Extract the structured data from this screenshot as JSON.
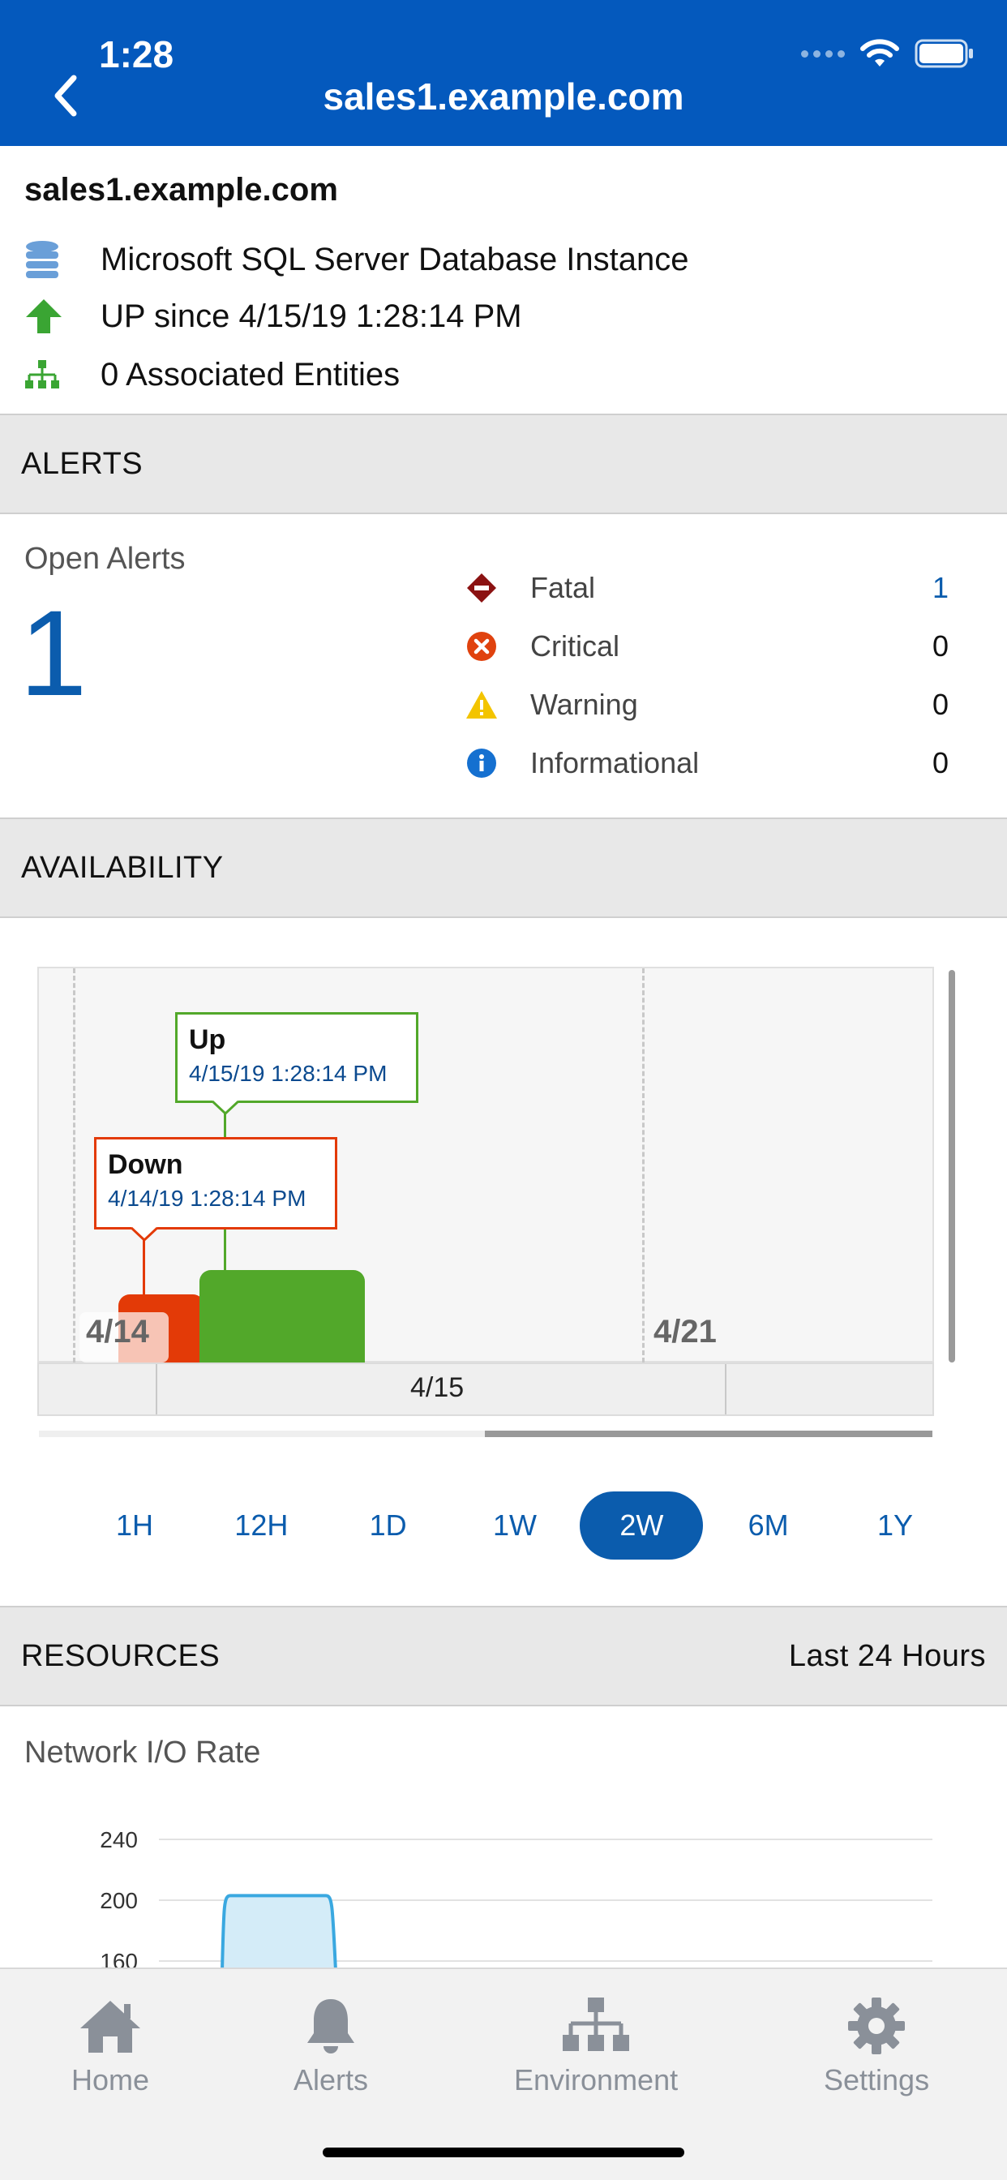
{
  "status_bar": {
    "time": "1:28"
  },
  "header": {
    "title": "sales1.example.com"
  },
  "summary": {
    "host": "sales1.example.com",
    "type": "Microsoft SQL Server Database Instance",
    "status": "UP since 4/15/19 1:28:14 PM",
    "entities": "0 Associated Entities"
  },
  "alerts": {
    "section_title": "ALERTS",
    "open_label": "Open Alerts",
    "open_count": "1",
    "items": [
      {
        "label": "Fatal",
        "value": "1",
        "icon": "fatal-diamond-icon",
        "color": "#8b1212"
      },
      {
        "label": "Critical",
        "value": "0",
        "icon": "critical-x-icon",
        "color": "#e0420e"
      },
      {
        "label": "Warning",
        "value": "0",
        "icon": "warning-triangle-icon",
        "color": "#f3c400"
      },
      {
        "label": "Informational",
        "value": "0",
        "icon": "info-icon",
        "color": "#1570d0"
      }
    ]
  },
  "availability": {
    "section_title": "AVAILABILITY",
    "up_callout": {
      "title": "Up",
      "date": "4/15/19 1:28:14 PM"
    },
    "down_callout": {
      "title": "Down",
      "date": "4/14/19 1:28:14 PM"
    },
    "date_left": "4/14",
    "date_right": "4/21",
    "axis_label": "4/15",
    "ranges": [
      "1H",
      "12H",
      "1D",
      "1W",
      "2W",
      "6M",
      "1Y"
    ],
    "active_range": "2W",
    "colors": {
      "up": "#52a82a",
      "down": "#e33a07"
    }
  },
  "resources": {
    "section_title": "RESOURCES",
    "range_label": "Last 24 Hours",
    "chart_title": "Network I/O Rate"
  },
  "chart_data": {
    "type": "area",
    "title": "Network I/O Rate",
    "yticks": [
      "240",
      "200",
      "160"
    ],
    "ylim": [
      160,
      240
    ],
    "series": [
      {
        "values": [
          0,
          203,
          203,
          0
        ]
      }
    ]
  },
  "tabbar": {
    "tabs": [
      {
        "label": "Home",
        "icon": "home-icon"
      },
      {
        "label": "Alerts",
        "icon": "bell-icon"
      },
      {
        "label": "Environment",
        "icon": "network-icon"
      },
      {
        "label": "Settings",
        "icon": "gear-icon"
      }
    ]
  }
}
